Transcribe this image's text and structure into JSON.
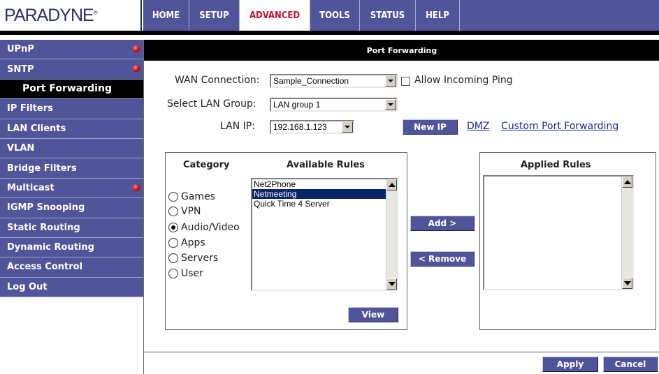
{
  "brand": {
    "logo_text": "PARADYNE",
    "trademark": "®"
  },
  "nav": {
    "tabs": [
      {
        "label": "HOME"
      },
      {
        "label": "SETUP"
      },
      {
        "label": "ADVANCED"
      },
      {
        "label": "TOOLS"
      },
      {
        "label": "STATUS"
      },
      {
        "label": "HELP"
      }
    ],
    "active": "ADVANCED"
  },
  "sidebar": {
    "items": [
      {
        "label": "UPnP",
        "alert": true
      },
      {
        "label": "SNTP",
        "alert": true
      },
      {
        "label": "Port Forwarding",
        "active": true
      },
      {
        "label": "IP Filters"
      },
      {
        "label": "LAN Clients"
      },
      {
        "label": "VLAN"
      },
      {
        "label": "Bridge Filters"
      },
      {
        "label": "Multicast",
        "alert": true
      },
      {
        "label": "IGMP Snooping"
      },
      {
        "label": "Static Routing"
      },
      {
        "label": "Dynamic Routing"
      },
      {
        "label": "Access Control"
      },
      {
        "label": "Log Out"
      }
    ]
  },
  "page": {
    "title": "Port Forwarding"
  },
  "form": {
    "wan_label": "WAN Connection:",
    "wan_value": "Sample_Connection",
    "ping_label": "Allow Incoming Ping",
    "group_label": "Select LAN Group:",
    "group_value": "LAN group 1",
    "lanip_label": "LAN IP:",
    "lanip_value": "192.168.1.123"
  },
  "actions": {
    "new_ip": "New IP",
    "dmz": "DMZ",
    "custom": "Custom Port Forwarding",
    "add": "Add >",
    "remove": "< Remove",
    "view": "View",
    "apply": "Apply",
    "cancel": "Cancel"
  },
  "rules": {
    "category_header": "Category",
    "available_header": "Available Rules",
    "applied_header": "Applied Rules",
    "categories": [
      "Games",
      "VPN",
      "Audio/Video",
      "Apps",
      "Servers",
      "User"
    ],
    "selected_category": "Audio/Video",
    "available": [
      "Net2Phone",
      "Netmeeting",
      "Quick Time 4 Server"
    ],
    "selected_available": "Netmeeting",
    "applied": []
  },
  "colors": {
    "nav_bg": "#50559a",
    "active_tab_text": "#c4122e",
    "sidebar_bg": "#50559a",
    "title_bar": "#000000",
    "link": "#1a2c8c"
  }
}
